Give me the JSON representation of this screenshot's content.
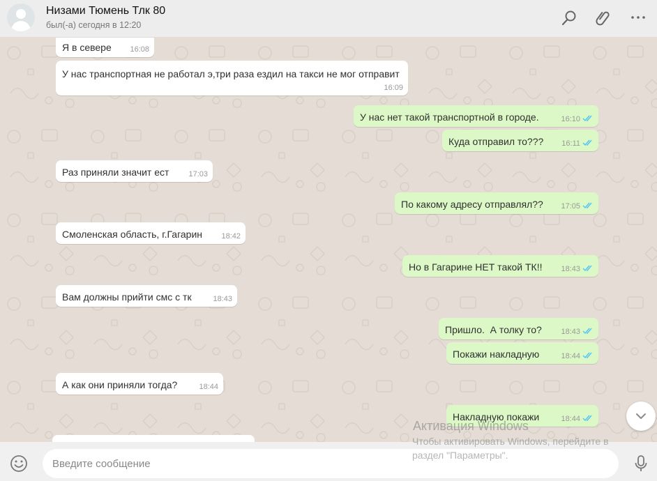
{
  "header": {
    "contact_name": "Низами Тюмень Тлк 80",
    "status": "был(-а) сегодня в 12:20",
    "icons": [
      "search-icon",
      "paperclip-icon",
      "menu-dots-icon"
    ]
  },
  "messages": [
    {
      "dir": "in",
      "text": "Я в севере",
      "time": "16:08"
    },
    {
      "dir": "in",
      "text": "У нас транспортная не работал э,три раза ездил на такси не мог отправит",
      "time": "16:09"
    },
    {
      "dir": "out",
      "text": "У нас нет такой транспортной в городе.",
      "time": "16:10",
      "status": "read"
    },
    {
      "dir": "out",
      "text": "Куда отправил то???",
      "time": "16:11",
      "status": "read"
    },
    {
      "dir": "in",
      "text": "Раз приняли значит ест",
      "time": "17:03"
    },
    {
      "dir": "out",
      "text": "По какому адресу отправлял??",
      "time": "17:05",
      "status": "read"
    },
    {
      "dir": "in",
      "text": "Смоленская область, г.Гагарин",
      "time": "18:42"
    },
    {
      "dir": "out",
      "text": "Но в Гагарине НЕТ такой ТК!!",
      "time": "18:43",
      "status": "read"
    },
    {
      "dir": "in",
      "text": "Вам должны прийти смс с тк",
      "time": "18:43"
    },
    {
      "dir": "out",
      "text": "Пришло.  А толку то?",
      "time": "18:43",
      "status": "read"
    },
    {
      "dir": "out",
      "text": "Покажи накладную",
      "time": "18:44",
      "status": "read"
    },
    {
      "dir": "in",
      "text": "А как они приняли тогда?",
      "time": "18:44"
    },
    {
      "dir": "out",
      "text": "Накладную покажи",
      "time": "18:44",
      "status": "read"
    }
  ],
  "watermark": {
    "title": "Активация Windows",
    "line1": "Чтобы активировать Windows, перейдите в",
    "line2": "раздел \"Параметры\"."
  },
  "composer": {
    "placeholder": "Введите сообщение"
  },
  "colors": {
    "incoming_bubble": "#ffffff",
    "outgoing_bubble": "#dcf8c6",
    "chat_background": "#e5ddd5",
    "read_ticks": "#4fc3f7",
    "header_background": "#ededed"
  }
}
